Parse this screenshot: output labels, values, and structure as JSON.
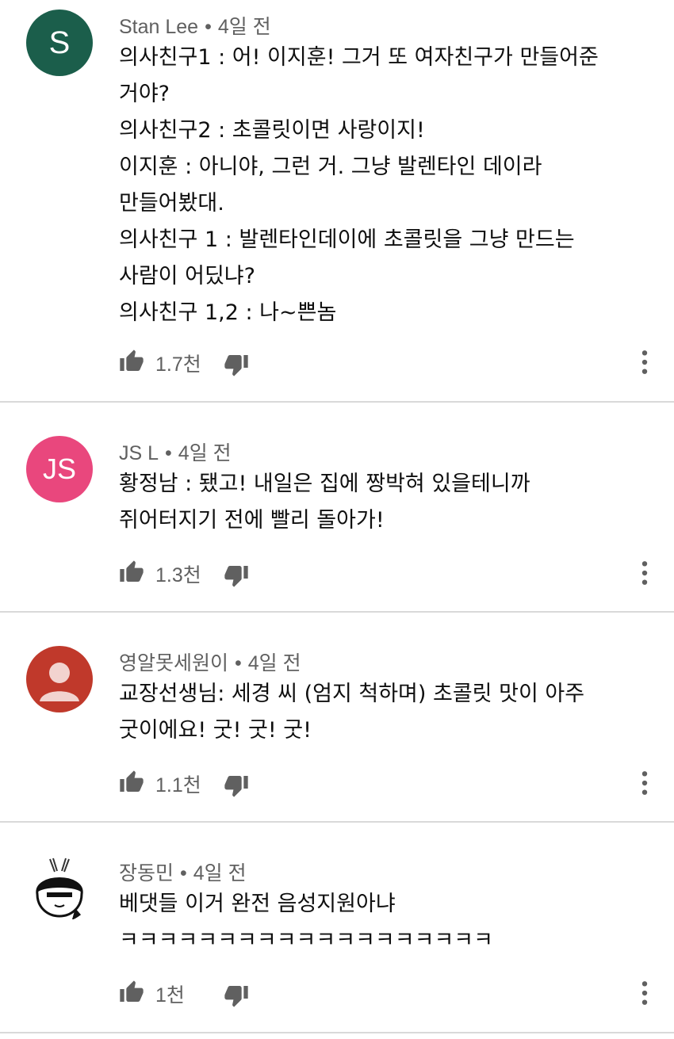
{
  "comments": [
    {
      "author": "Stan Lee",
      "time": "4일 전",
      "avatar_text": "S",
      "avatar_color": "#1b5e4b",
      "lines": [
        "의사친구1 : 어! 이지훈! 그거 또 여자친구가 만들어준",
        "거야?",
        "의사친구2 : 초콜릿이면 사랑이지!",
        "이지훈 : 아니야, 그런 거. 그냥 발렌타인 데이라",
        "만들어봤대.",
        "의사친구 1 : 발렌타인데이에 초콜릿을 그냥 만드는",
        "사람이 어딨냐?",
        "의사친구 1,2 : 나~쁜놈"
      ],
      "likes": "1.7천"
    },
    {
      "author": "JS L",
      "time": "4일 전",
      "avatar_text": "JS",
      "avatar_color": "#e9477d",
      "lines": [
        "황정남 : 됐고! 내일은 집에 짱박혀 있을테니까",
        "쥐어터지기 전에 빨리 돌아가!"
      ],
      "likes": "1.3천"
    },
    {
      "author": "영알못세원이",
      "time": "4일 전",
      "avatar_text": "",
      "avatar_color": "#c0392b",
      "lines": [
        "교장선생님: 세경 씨 (엄지 척하며) 초콜릿 맛이 아주",
        "굿이에요! 굿! 굿! 굿!"
      ],
      "likes": "1.1천"
    },
    {
      "author": "장동민",
      "time": "4일 전",
      "avatar_text": "",
      "avatar_color": "#ffffff",
      "lines": [
        "베댓들 이거 완전 음성지원아냐",
        "ㅋㅋㅋㅋㅋㅋㅋㅋㅋㅋㅋㅋㅋㅋㅋㅋㅋㅋㅋ"
      ],
      "likes": "1천"
    }
  ],
  "icons": {
    "like": "thumbs-up-icon",
    "dislike": "thumbs-down-icon",
    "more": "more-vertical-icon",
    "default_avatar": "person-icon"
  },
  "colors": {
    "meta_text": "#606060",
    "icon": "#606060",
    "divider": "#d9d9d9"
  }
}
